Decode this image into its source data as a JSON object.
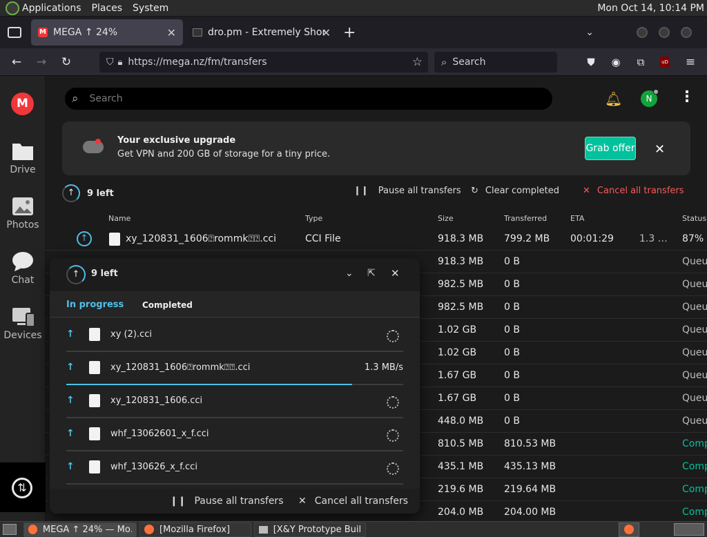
{
  "system_bar": {
    "menus": [
      "Applications",
      "Places",
      "System"
    ],
    "clock": "Mon Oct 14, 10:14 PM"
  },
  "browser": {
    "tabs": [
      {
        "title": "MEGA ↑ 24%",
        "active": true
      },
      {
        "title": "dro.pm - Extremely Short Li",
        "active": false
      }
    ],
    "url": "https://mega.nz/fm/transfers",
    "search_placeholder": "Search"
  },
  "mega_sidebar": {
    "items": [
      "Drive",
      "Photos",
      "Chat",
      "Devices"
    ]
  },
  "top_search": {
    "placeholder": "Search"
  },
  "avatar_initial": "N",
  "banner": {
    "title": "Your exclusive upgrade",
    "text": "Get VPN and 200 GB of storage for a tiny price.",
    "button": "Grab offer"
  },
  "transfers_toolbar": {
    "left_count": "9 left",
    "pause_all": "Pause all transfers",
    "clear_completed": "Clear completed",
    "cancel_all": "Cancel all transfers"
  },
  "table": {
    "headers": [
      "Name",
      "Type",
      "Size",
      "Transferred",
      "ETA",
      "Status"
    ],
    "rows": [
      {
        "name": "xy_120831_1606⍰rommk⍰⍰.cci",
        "type": "CCI File",
        "size": "918.3 MB",
        "transferred": "799.2 MB",
        "eta": "00:01:29",
        "speed": "1.3 …",
        "status": "87%",
        "status_kind": "progress"
      },
      {
        "size": "918.3 MB",
        "transferred": "0 B",
        "status": "Queu",
        "status_kind": "queued"
      },
      {
        "size": "982.5 MB",
        "transferred": "0 B",
        "status": "Queu",
        "status_kind": "queued"
      },
      {
        "size": "982.5 MB",
        "transferred": "0 B",
        "status": "Queu",
        "status_kind": "queued"
      },
      {
        "size": "1.02 GB",
        "transferred": "0 B",
        "status": "Queu",
        "status_kind": "queued"
      },
      {
        "size": "1.02 GB",
        "transferred": "0 B",
        "status": "Queu",
        "status_kind": "queued"
      },
      {
        "size": "1.67 GB",
        "transferred": "0 B",
        "status": "Queu",
        "status_kind": "queued"
      },
      {
        "size": "1.67 GB",
        "transferred": "0 B",
        "status": "Queu",
        "status_kind": "queued"
      },
      {
        "size": "448.0 MB",
        "transferred": "0 B",
        "status": "Queu",
        "status_kind": "queued"
      },
      {
        "size": "810.5 MB",
        "transferred": "810.53 MB",
        "status": "Comp",
        "status_kind": "complete"
      },
      {
        "size": "435.1 MB",
        "transferred": "435.13 MB",
        "status": "Comp",
        "status_kind": "complete"
      },
      {
        "size": "219.6 MB",
        "transferred": "219.64 MB",
        "status": "Comp",
        "status_kind": "complete"
      },
      {
        "size": "204.0 MB",
        "transferred": "204.00 MB",
        "status": "Comp",
        "status_kind": "complete"
      }
    ]
  },
  "panel": {
    "left_count": "9 left",
    "tab_in_progress": "In progress",
    "tab_completed": "Completed",
    "items": [
      {
        "name": "xy (2).cci",
        "speed": "",
        "progress": 0
      },
      {
        "name": "xy_120831_1606⍰rommk⍰⍰.cci",
        "speed": "1.3 MB/s",
        "progress": 0.87
      },
      {
        "name": "xy_120831_1606.cci",
        "speed": "",
        "progress": 0
      },
      {
        "name": "whf_13062601_x_f.cci",
        "speed": "",
        "progress": 0
      },
      {
        "name": "whf_130626_x_f.cci",
        "speed": "",
        "progress": 0
      }
    ],
    "pause_all": "Pause all transfers",
    "cancel_all": "Cancel all transfers"
  },
  "taskbar": {
    "items": [
      "MEGA ↑ 24% — Mo…",
      "[Mozilla Firefox]",
      "[X&Y Prototype Buil…"
    ]
  },
  "colors": {
    "accent": "#00c29d",
    "mega_red": "#f0373a",
    "cancel_red": "#f95b5b",
    "progress_blue": "#4fbfe8"
  }
}
